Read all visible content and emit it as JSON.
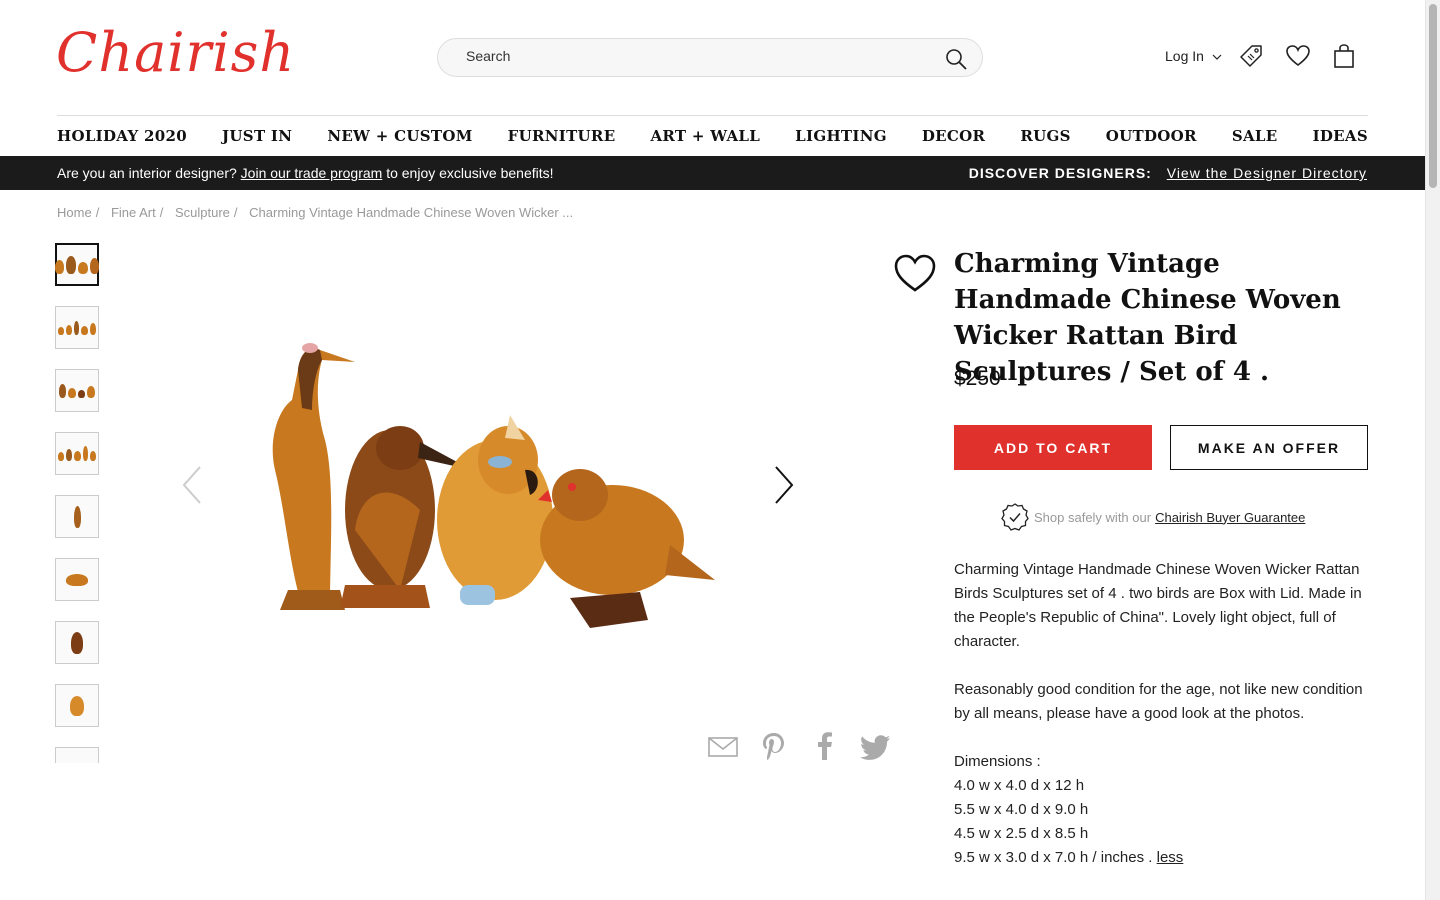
{
  "header": {
    "logo": "Chairish",
    "search_placeholder": "Search",
    "login_label": "Log In"
  },
  "nav": [
    "HOLIDAY 2020",
    "JUST IN",
    "NEW + CUSTOM",
    "FURNITURE",
    "ART + WALL",
    "LIGHTING",
    "DECOR",
    "RUGS",
    "OUTDOOR",
    "SALE",
    "IDEAS"
  ],
  "promo": {
    "question": "Are you an interior designer?",
    "link": "Join our trade program",
    "suffix": "to enjoy exclusive benefits!",
    "discover_label": "DISCOVER DESIGNERS:",
    "discover_link": "View the Designer Directory"
  },
  "breadcrumb": [
    "Home",
    "Fine Art",
    "Sculpture",
    "Charming Vintage Handmade Chinese Woven Wicker ..."
  ],
  "product": {
    "title": "Charming Vintage Handmade Chinese Woven Wicker Rattan Bird Sculptures / Set of 4 .",
    "price": "$250",
    "add_to_cart": "ADD TO CART",
    "make_offer": "MAKE AN OFFER",
    "guarantee_text": "Shop safely with our",
    "guarantee_link": "Chairish Buyer Guarantee",
    "description_1": "Charming Vintage Handmade Chinese Woven Wicker Rattan Birds Sculptures set of 4 . two birds are Box with Lid. Made in the People's Republic of China\". Lovely light object, full of character.",
    "description_2": "Reasonably good condition for the age, not like new condition by all means, please have a good look at the photos.",
    "dimensions_label": "Dimensions :",
    "dimensions": [
      "4.0 w x 4.0 d x 12 h",
      "5.5 w x 4.0 d x 9.0 h",
      "4.5 w x 2.5 d x 8.5 h"
    ],
    "dimensions_last": "9.5 w x 3.0 d x 7.0 h / inches .",
    "less_link": "less"
  },
  "colors": {
    "brand_red": "#e0312d",
    "promo_bg": "#1b1b1b",
    "wicker": "#c8791f"
  },
  "icons": [
    "search-icon",
    "chevron-down-icon",
    "tag-icon",
    "heart-icon",
    "shopping-bag-icon",
    "arrow-left-icon",
    "arrow-right-icon",
    "mail-icon",
    "pinterest-icon",
    "facebook-icon",
    "twitter-icon",
    "shield-check-icon"
  ]
}
